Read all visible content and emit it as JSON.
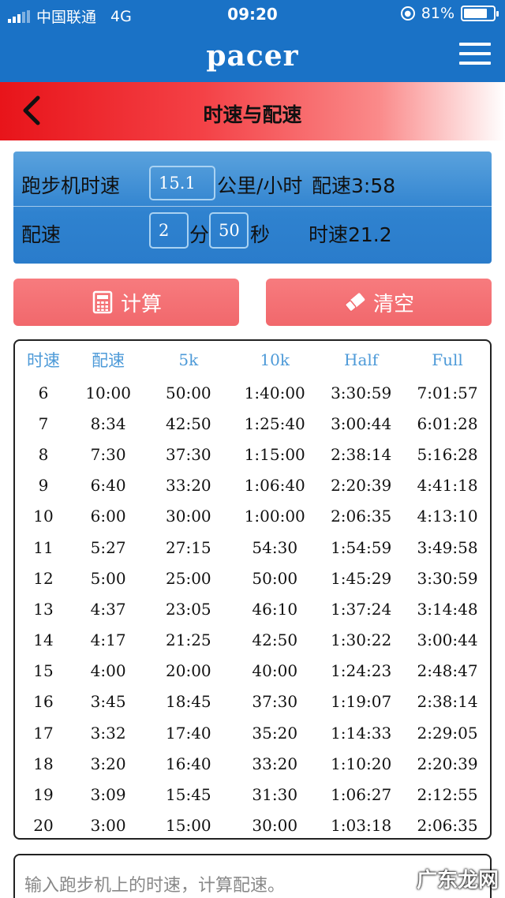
{
  "status_bar": {
    "carrier": "中国联通",
    "network": "4G",
    "time": "09:20",
    "battery_percent": "81%",
    "battery_level": 0.81,
    "rotation_lock_icon": "rotation-lock-icon"
  },
  "app": {
    "brand": "pacer",
    "menu_icon": "hamburger-menu-icon"
  },
  "page": {
    "title": "时速与配速",
    "back_icon": "chevron-left-icon"
  },
  "calculator": {
    "treadmill_label": "跑步机时速",
    "speed_value": "15.1",
    "speed_unit": "公里/小时",
    "pace_result": "配速3:58",
    "pace_label": "配速",
    "pace_minutes": "2",
    "minutes_unit": "分",
    "pace_seconds": "50",
    "seconds_unit": "秒",
    "speed_result": "时速21.2"
  },
  "actions": {
    "calculate_label": "计算",
    "calculate_icon": "calculator-icon",
    "clear_label": "清空",
    "clear_icon": "eraser-icon"
  },
  "table": {
    "headers": [
      "时速",
      "配速",
      "5k",
      "10k",
      "Half",
      "Full"
    ],
    "rows": [
      [
        "6",
        "10:00",
        "50:00",
        "1:40:00",
        "3:30:59",
        "7:01:57"
      ],
      [
        "7",
        "8:34",
        "42:50",
        "1:25:40",
        "3:00:44",
        "6:01:28"
      ],
      [
        "8",
        "7:30",
        "37:30",
        "1:15:00",
        "2:38:14",
        "5:16:28"
      ],
      [
        "9",
        "6:40",
        "33:20",
        "1:06:40",
        "2:20:39",
        "4:41:18"
      ],
      [
        "10",
        "6:00",
        "30:00",
        "1:00:00",
        "2:06:35",
        "4:13:10"
      ],
      [
        "11",
        "5:27",
        "27:15",
        "54:30",
        "1:54:59",
        "3:49:58"
      ],
      [
        "12",
        "5:00",
        "25:00",
        "50:00",
        "1:45:29",
        "3:30:59"
      ],
      [
        "13",
        "4:37",
        "23:05",
        "46:10",
        "1:37:24",
        "3:14:48"
      ],
      [
        "14",
        "4:17",
        "21:25",
        "42:50",
        "1:30:22",
        "3:00:44"
      ],
      [
        "15",
        "4:00",
        "20:00",
        "40:00",
        "1:24:23",
        "2:48:47"
      ],
      [
        "16",
        "3:45",
        "18:45",
        "37:30",
        "1:19:07",
        "2:38:14"
      ],
      [
        "17",
        "3:32",
        "17:40",
        "35:20",
        "1:14:33",
        "2:29:05"
      ],
      [
        "18",
        "3:20",
        "16:40",
        "33:20",
        "1:10:20",
        "2:20:39"
      ],
      [
        "19",
        "3:09",
        "15:45",
        "31:30",
        "1:06:27",
        "2:12:55"
      ],
      [
        "20",
        "3:00",
        "15:00",
        "30:00",
        "1:03:18",
        "2:06:35"
      ]
    ]
  },
  "note": {
    "text": "输入跑步机上的时速，计算配速。"
  },
  "watermark": "广东龙网",
  "colors": {
    "app_blue": "#1a72c6",
    "header_red": "#e8141a",
    "button_red": "#f1686c",
    "table_header_blue": "#4d9ad8"
  }
}
